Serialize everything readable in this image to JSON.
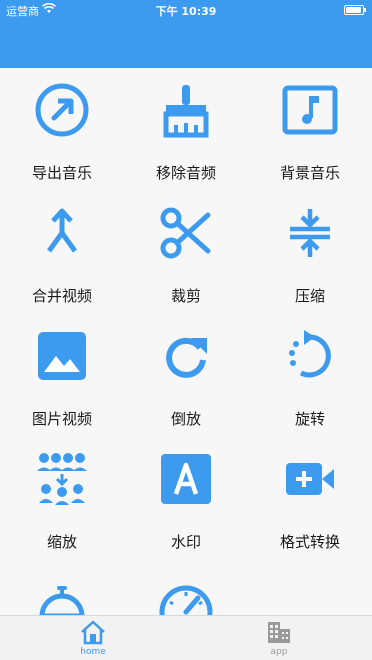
{
  "status_bar": {
    "carrier": "运营商",
    "time": "下午 10:39"
  },
  "grid": {
    "items": [
      {
        "label": "导出音乐",
        "icon": "export-music-icon"
      },
      {
        "label": "移除音频",
        "icon": "remove-audio-icon"
      },
      {
        "label": "背景音乐",
        "icon": "background-music-icon"
      },
      {
        "label": "合并视频",
        "icon": "merge-video-icon"
      },
      {
        "label": "裁剪",
        "icon": "crop-scissors-icon"
      },
      {
        "label": "压缩",
        "icon": "compress-icon"
      },
      {
        "label": "图片视频",
        "icon": "image-video-icon"
      },
      {
        "label": "倒放",
        "icon": "reverse-icon"
      },
      {
        "label": "旋转",
        "icon": "rotate-icon"
      },
      {
        "label": "缩放",
        "icon": "scale-icon"
      },
      {
        "label": "水印",
        "icon": "watermark-icon"
      },
      {
        "label": "格式转换",
        "icon": "format-convert-icon"
      },
      {
        "label": "",
        "icon": "bell-icon"
      },
      {
        "label": "",
        "icon": "speed-icon"
      }
    ]
  },
  "tab_bar": {
    "tabs": [
      {
        "label": "home",
        "icon": "home-icon",
        "active": true
      },
      {
        "label": "app",
        "icon": "building-icon",
        "active": false
      }
    ]
  },
  "colors": {
    "accent": "#3d9bef",
    "tab_inactive": "#9a9a9a",
    "background": "#f7f7f7"
  }
}
